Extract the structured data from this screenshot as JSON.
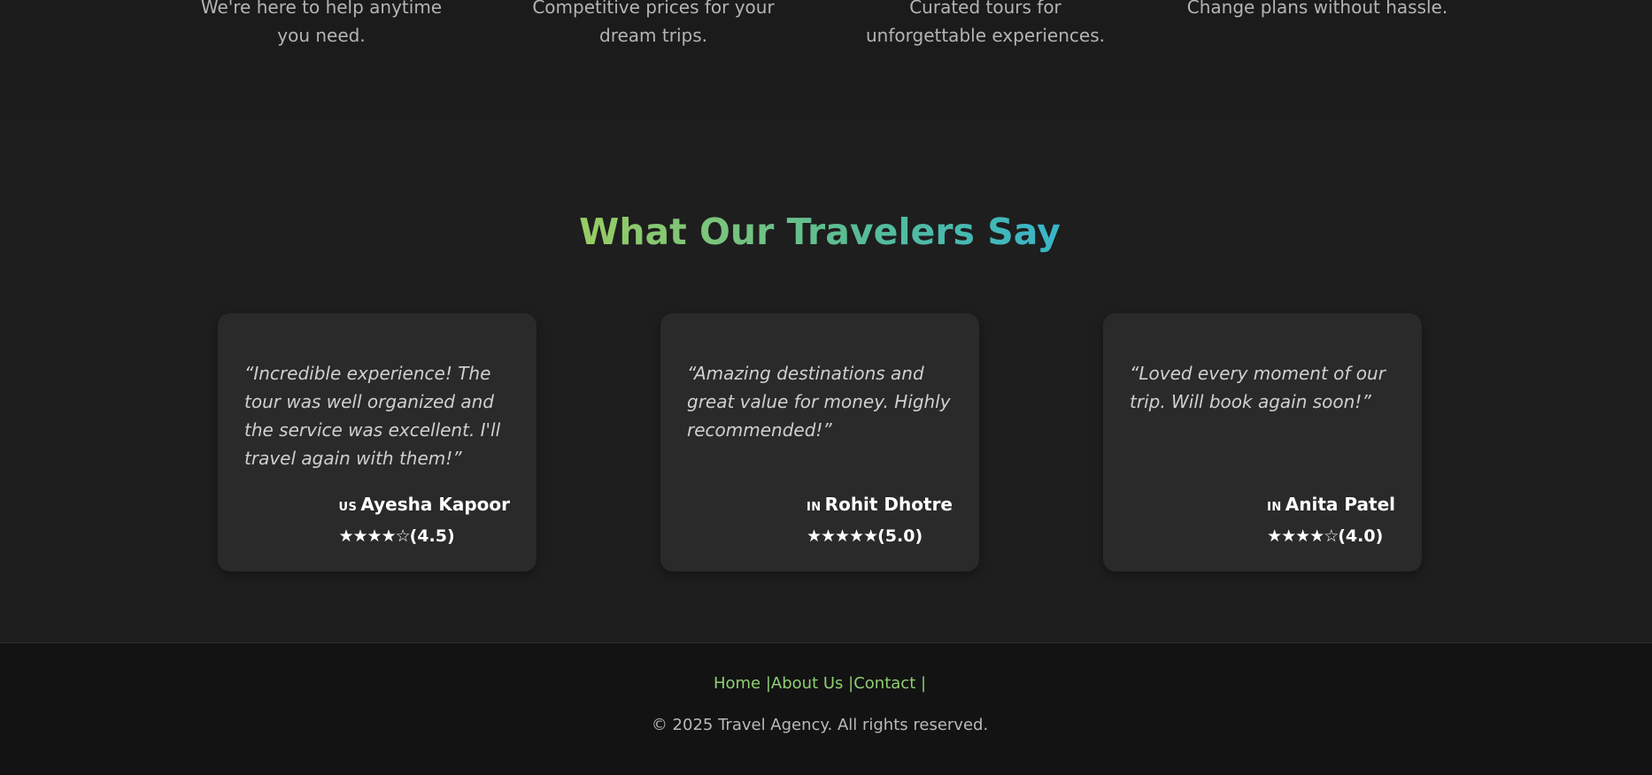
{
  "features": [
    {
      "description": "We're here to help anytime you need."
    },
    {
      "description": "Competitive prices for your dream trips."
    },
    {
      "description": "Curated tours for unforgettable experiences."
    },
    {
      "description": "Change plans without hassle."
    }
  ],
  "testimonials": {
    "title": "What Our Travelers Say",
    "cards": [
      {
        "quote": "“Incredible experience! The tour was well organized and the service was excellent. I'll travel again with them!”",
        "flag": "US",
        "name": "Ayesha Kapoor",
        "stars": "★★★★☆",
        "score": "(4.5)",
        "rating": 4.5
      },
      {
        "quote": "“Amazing destinations and great value for money. Highly recommended!”",
        "flag": "IN",
        "name": "Rohit Dhotre",
        "stars": "★★★★★",
        "score": "(5.0)",
        "rating": 5.0
      },
      {
        "quote": "“Loved every moment of our trip. Will book again soon!”",
        "flag": "IN",
        "name": "Anita Patel",
        "stars": "★★★★☆",
        "score": "(4.0)",
        "rating": 4.0
      }
    ]
  },
  "footer": {
    "links": [
      {
        "label": "Home"
      },
      {
        "label": "About Us"
      },
      {
        "label": "Contact"
      }
    ],
    "separator": "|",
    "copyright": "© 2025 Travel Agency. All rights reserved."
  },
  "colors": {
    "accent_green": "#8fcf73",
    "title_gradient_start": "#99cc63",
    "title_gradient_end": "#38b5c9",
    "card_bg": "#2a2a2a",
    "page_bg": "#1b1b1b"
  }
}
